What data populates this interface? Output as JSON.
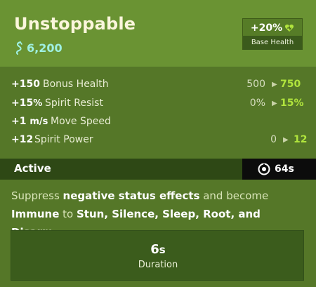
{
  "item": {
    "name": "Unstoppable",
    "price": "6,200",
    "price_icon": "souls-currency-icon"
  },
  "base_badge": {
    "value": "+20%",
    "icon": "health-icon",
    "label": "Base Health"
  },
  "stats": [
    {
      "bonus": "+150",
      "unit": "",
      "label": "Bonus Health",
      "from": "500",
      "to": "750"
    },
    {
      "bonus": "+15",
      "unit": "%",
      "label": "Spirit Resist",
      "from": "0%",
      "to": "15%"
    },
    {
      "bonus": "+1",
      "unit": "m/s",
      "label": "Move Speed",
      "from": "",
      "to": ""
    },
    {
      "bonus": "+12",
      "unit": "",
      "label": "Spirit Power",
      "from": "0",
      "to": "12"
    }
  ],
  "active": {
    "label": "Active",
    "cooldown": "64s",
    "cooldown_icon": "cooldown-clock-icon"
  },
  "description": {
    "p1": "Suppress ",
    "h1": "negative status effects",
    "p2": " and become ",
    "h2": "Immune",
    "p3": " to ",
    "h3": "Stun, Silence, Sleep, Root, and Disarm",
    "p4": "."
  },
  "duration": {
    "value": "6",
    "unit": "s",
    "label": "Duration"
  },
  "colors": {
    "header_bg": "#6a9333",
    "body_bg": "#557728",
    "accent_green": "#b1e53d",
    "price_color": "#9ff0e2",
    "active_bar": "#2e4815",
    "cooldown_bg": "#0c0c0c"
  }
}
